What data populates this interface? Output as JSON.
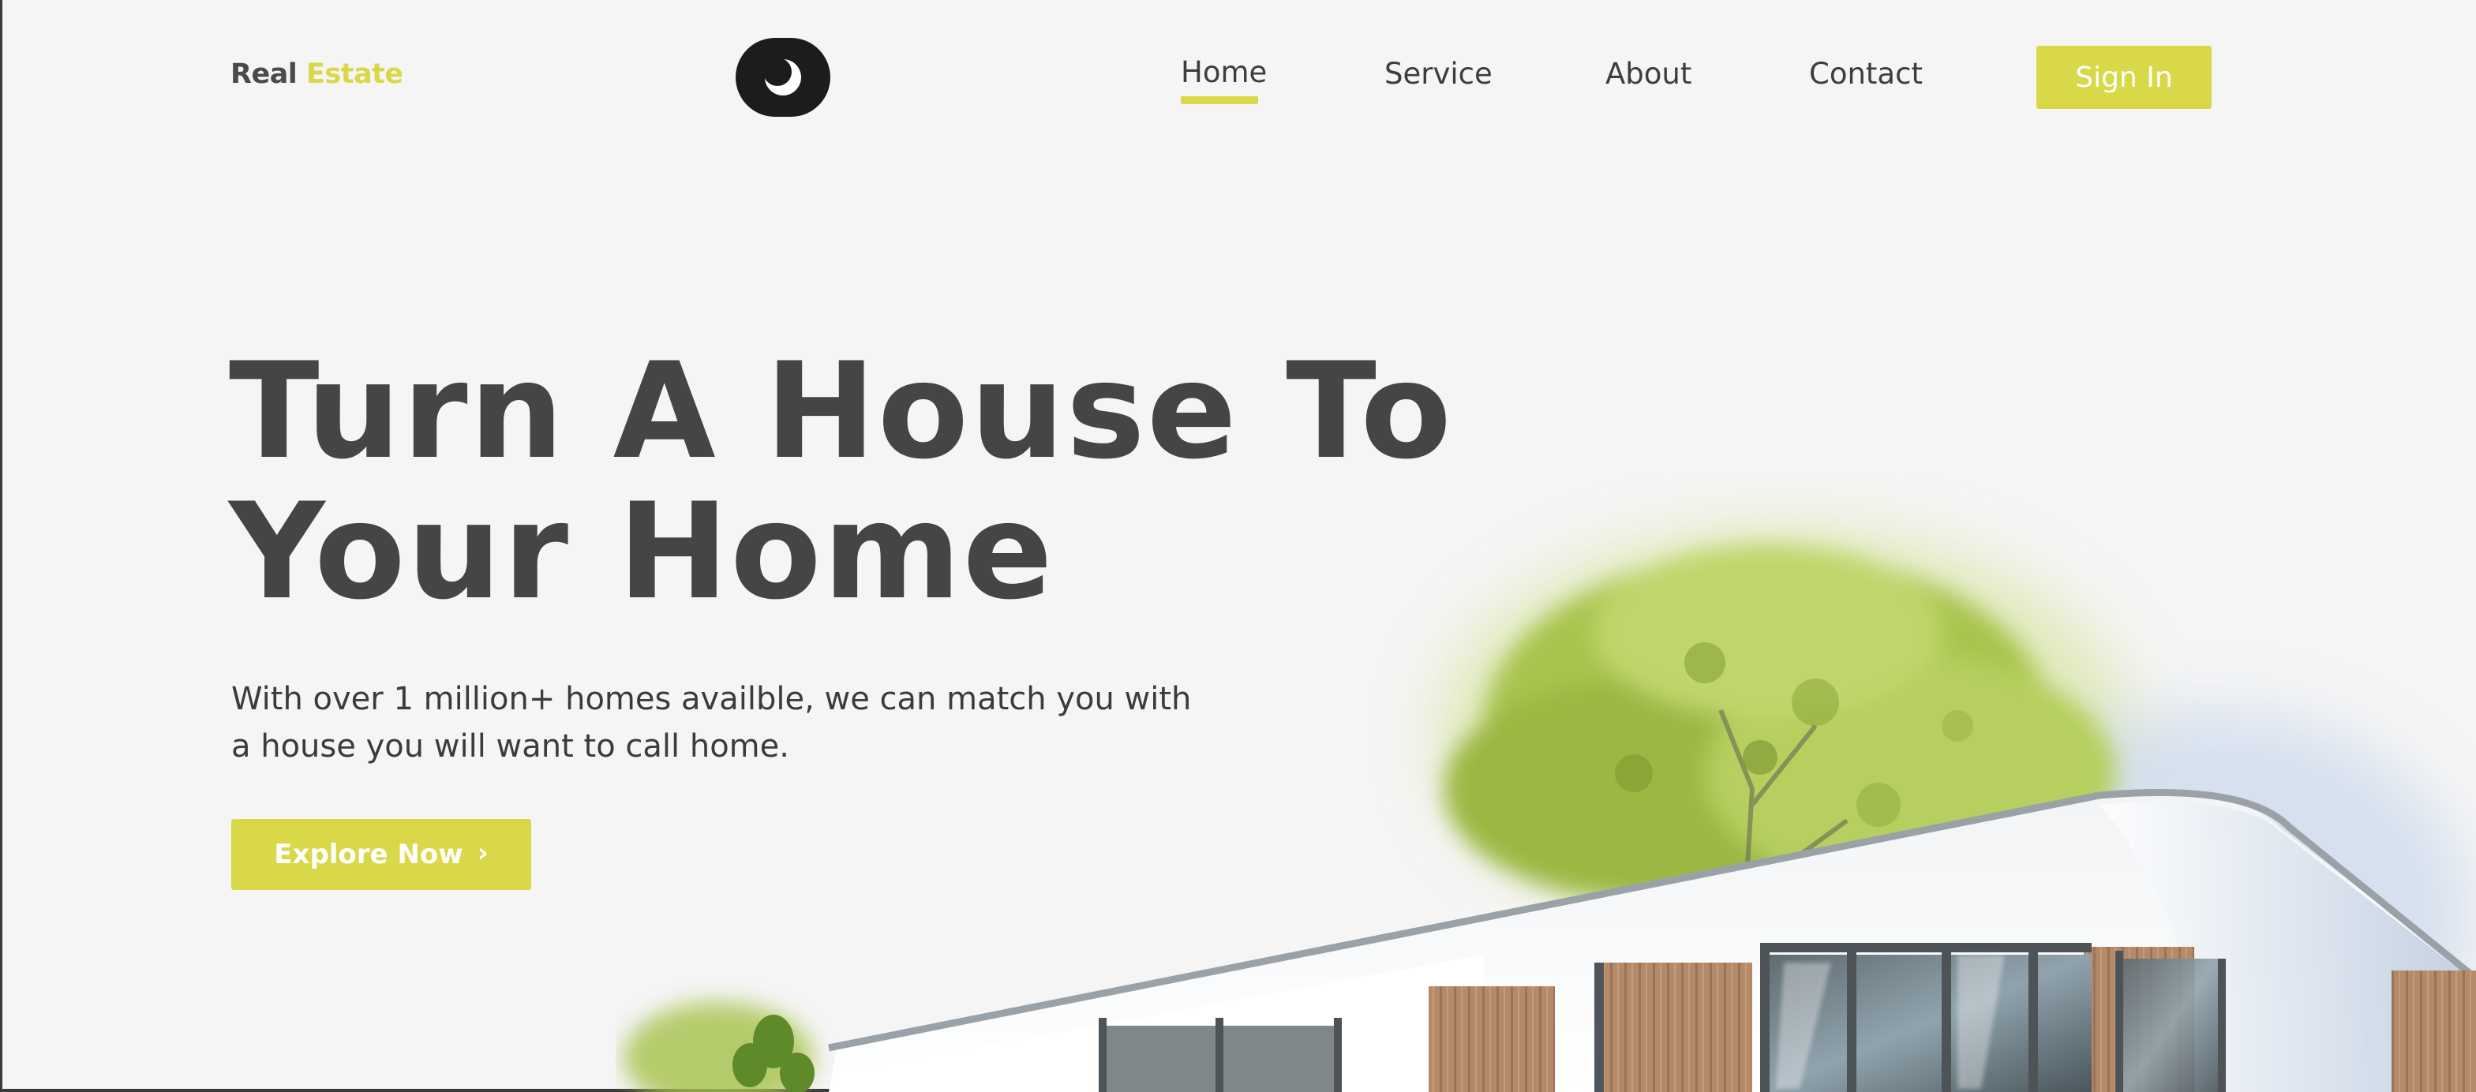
{
  "header": {
    "logo": {
      "word1": "Real",
      "word2": "Estate"
    },
    "theme_toggle_icon": "moon-icon",
    "nav": [
      {
        "label": "Home",
        "active": true
      },
      {
        "label": "Service",
        "active": false
      },
      {
        "label": "About",
        "active": false
      },
      {
        "label": "Contact",
        "active": false
      }
    ],
    "sign_in_label": "Sign In"
  },
  "hero": {
    "title_line1": "Turn A House To",
    "title_line2": "Your Home",
    "subtitle_line1": "With over 1 million+ homes availble, we can match you with",
    "subtitle_line2": "a house you will want to call home.",
    "cta_label": "Explore Now",
    "cta_icon": "chevron-right-icon"
  },
  "image": {
    "subject": "house-with-tree-image"
  },
  "colors": {
    "accent": "#d9d848",
    "text_dark": "#454545",
    "background": "#f5f5f5",
    "toggle_bg": "#1c1c1c"
  }
}
